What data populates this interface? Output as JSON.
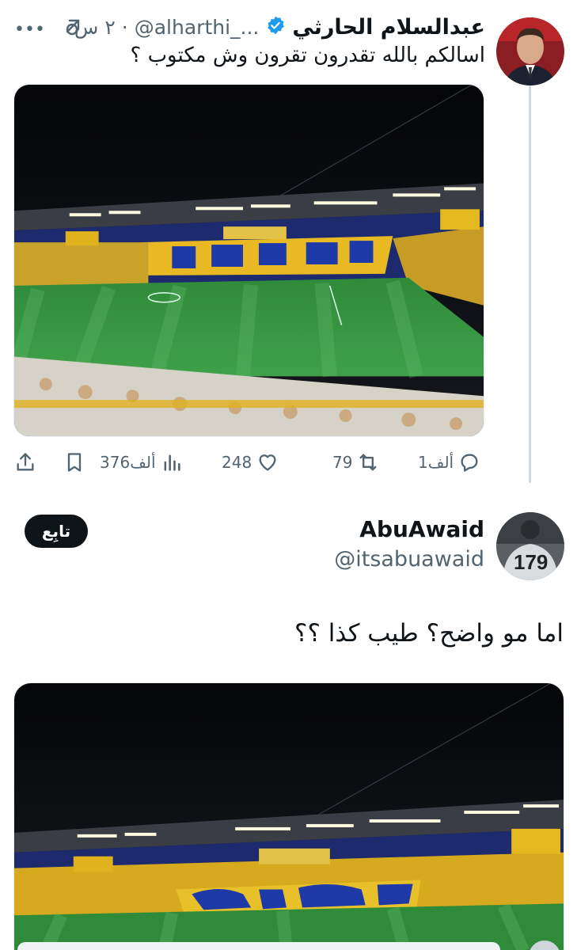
{
  "parent": {
    "name": "عبدالسلام الحارثي",
    "handle": "@alharthi_...",
    "dot": "·",
    "time": "٢ س",
    "text": "اسالكم بالله تقدرون تقرون وش مكتوب ؟",
    "stats": {
      "views": "376ألف",
      "likes": "248",
      "retweets": "79",
      "replies": "1ألف"
    }
  },
  "reply": {
    "name": "AbuAwaid",
    "handle": "@itsabuawaid",
    "follow_label": "تابِع",
    "text": "اما مو واضح؟ طيب كذا ؟؟"
  },
  "icons": {
    "more": "more-icon",
    "grok": "grok-icon",
    "verified": "verified-badge-icon",
    "share": "share-icon",
    "bookmark": "bookmark-icon",
    "views": "views-icon",
    "like": "heart-icon",
    "retweet": "retweet-icon",
    "reply": "reply-icon"
  },
  "colors": {
    "text": "#0f1419",
    "secondary": "#536471",
    "verified": "#1d9bf0",
    "thread_line": "#cfd9de"
  }
}
